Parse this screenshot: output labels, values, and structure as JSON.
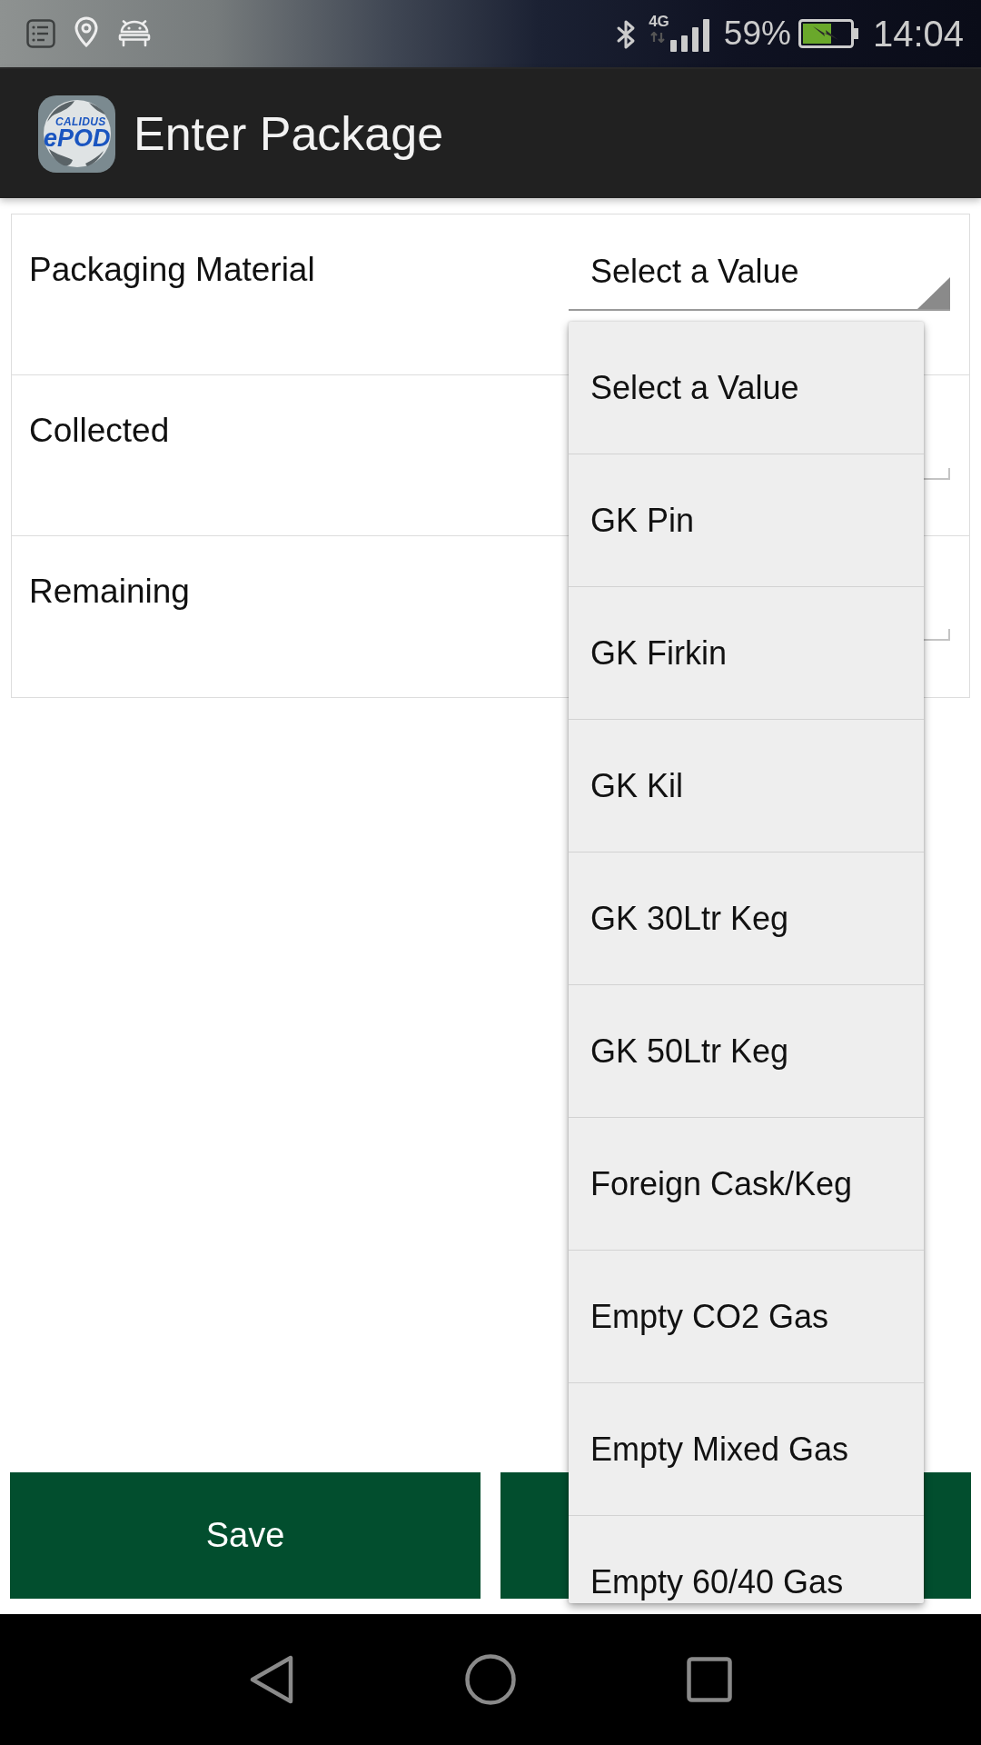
{
  "status_bar": {
    "network_type": "4G",
    "battery_percent": "59%",
    "time": "14:04"
  },
  "app_bar": {
    "logo": {
      "caption": "CALIDUS",
      "wordmark": "ePOD"
    },
    "title": "Enter Package"
  },
  "form": {
    "rows": [
      {
        "label": "Packaging Material",
        "kind": "spinner",
        "value": "Select a Value",
        "expanded": true,
        "options": [
          "Select a Value",
          "GK Pin",
          "GK Firkin",
          "GK Kil",
          "GK 30Ltr Keg",
          "GK 50Ltr Keg",
          "Foreign Cask/Keg",
          "Empty CO2 Gas",
          "Empty Mixed Gas",
          "Empty 60/40 Gas"
        ]
      },
      {
        "label": "Collected",
        "kind": "text_field"
      },
      {
        "label": "Remaining",
        "kind": "text_field"
      }
    ]
  },
  "buttons": [
    {
      "kind": "labeled",
      "label": "Save"
    },
    {
      "kind": "covered"
    }
  ]
}
